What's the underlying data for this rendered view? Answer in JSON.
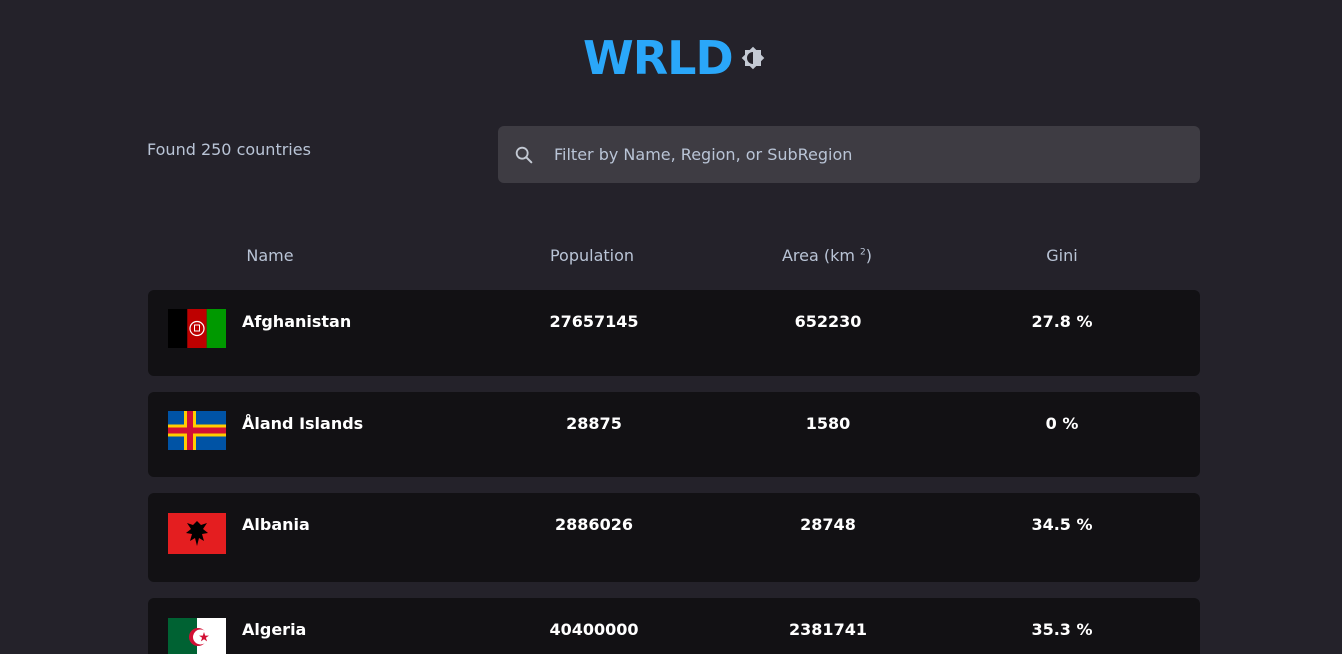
{
  "app": {
    "title": "WRLD"
  },
  "theme_toggle": {
    "icon": "brightness-icon"
  },
  "summary": {
    "found_text": "Found 250 countries"
  },
  "search": {
    "placeholder": "Filter by Name, Region, or SubRegion",
    "value": "",
    "icon": "search-icon"
  },
  "columns": {
    "name": "Name",
    "population": "Population",
    "area": "Area (km",
    "area_sup": "2",
    "area_close": ")",
    "gini": "Gini"
  },
  "countries": [
    {
      "name": "Afghanistan",
      "population": "27657145",
      "area": "652230",
      "gini": "27.8 %",
      "flag": "afghanistan-flag"
    },
    {
      "name": "Åland Islands",
      "population": "28875",
      "area": "1580",
      "gini": "0 %",
      "flag": "aland-islands-flag"
    },
    {
      "name": "Albania",
      "population": "2886026",
      "area": "28748",
      "gini": "34.5 %",
      "flag": "albania-flag"
    },
    {
      "name": "Algeria",
      "population": "40400000",
      "area": "2381741",
      "gini": "35.3 %",
      "flag": "algeria-flag"
    }
  ],
  "colors": {
    "background": "#24222a",
    "accent": "#2aa7f9",
    "row": "#121114",
    "search": "#3e3c43",
    "muted": "#b9c4d6"
  }
}
